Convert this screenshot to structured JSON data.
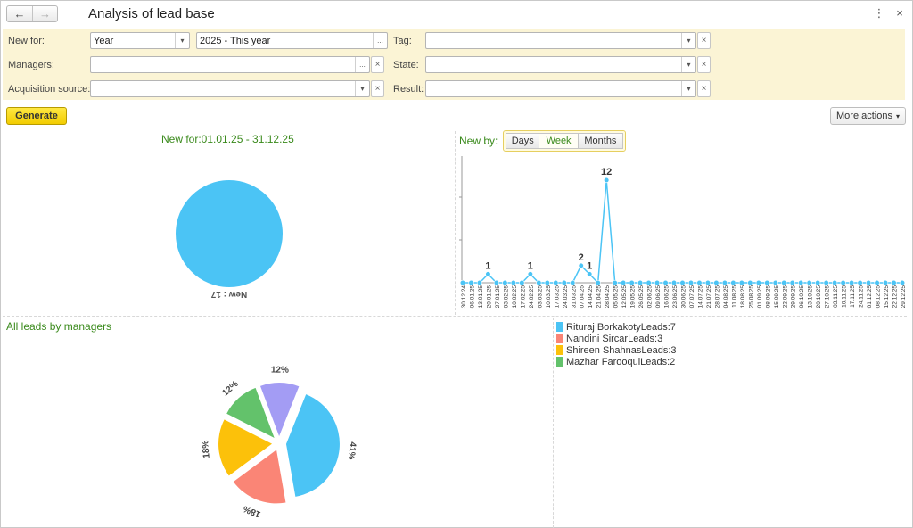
{
  "header": {
    "title": "Analysis of lead base",
    "back_icon": "←",
    "forward_icon": "→",
    "more_icon": "⋮",
    "close_icon": "×"
  },
  "filters": {
    "new_for_label": "New for:",
    "period_type_value": "Year",
    "period_value": "2025 - This year",
    "managers_label": "Managers:",
    "managers_value": "",
    "acquisition_label": "Acquisition source:",
    "acquisition_value": "",
    "tag_label": "Tag:",
    "tag_value": "",
    "state_label": "State:",
    "state_value": "",
    "result_label": "Result:",
    "result_value": "",
    "dropdown_glyph": "▾",
    "choice_glyph": "...",
    "clear_glyph": "×"
  },
  "actions": {
    "generate_label": "Generate",
    "more_actions_label": "More actions",
    "more_actions_arrow": "▾"
  },
  "new_for_chart": {
    "title": "New for:01.01.25 - 31.12.25",
    "slice_label": "New : 17",
    "color": "#4bc4f5"
  },
  "new_by": {
    "label": "New by:",
    "buttons": [
      "Days",
      "Week",
      "Months"
    ],
    "active": "Week"
  },
  "managers_chart": {
    "title": "All leads by managers"
  },
  "chart_data": [
    {
      "type": "pie",
      "title": "New for:01.01.25 - 31.12.25",
      "slices": [
        {
          "label": "New : 17",
          "value": 17,
          "color": "#4bc4f5"
        }
      ]
    },
    {
      "type": "line",
      "title": "New by:",
      "color": "#4bc4f5",
      "x": [
        "30.12.24",
        "06.01.25",
        "13.01.25",
        "20.01.25",
        "27.01.25",
        "03.02.25",
        "10.02.25",
        "17.02.25",
        "24.02.25",
        "03.03.25",
        "10.03.25",
        "17.03.25",
        "24.03.25",
        "31.03.25",
        "07.04.25",
        "14.04.25",
        "21.04.25",
        "28.04.25",
        "05.05.25",
        "12.05.25",
        "19.05.25",
        "26.05.25",
        "02.06.25",
        "09.06.25",
        "16.06.25",
        "23.06.25",
        "30.06.25",
        "07.07.25",
        "14.07.25",
        "21.07.25",
        "28.07.25",
        "04.08.25",
        "11.08.25",
        "18.08.25",
        "25.08.25",
        "01.09.25",
        "08.09.25",
        "15.09.25",
        "22.09.25",
        "29.09.25",
        "06.10.25",
        "13.10.25",
        "20.10.25",
        "27.10.25",
        "03.11.25",
        "10.11.25",
        "17.11.25",
        "24.11.25",
        "01.12.25",
        "08.12.25",
        "15.12.25",
        "22.12.25",
        "29.12.25"
      ],
      "values": [
        0,
        0,
        0,
        1,
        0,
        0,
        0,
        0,
        1,
        0,
        0,
        0,
        0,
        0,
        2,
        1,
        0,
        12,
        0,
        0,
        0,
        0,
        0,
        0,
        0,
        0,
        0,
        0,
        0,
        0,
        0,
        0,
        0,
        0,
        0,
        0,
        0,
        0,
        0,
        0,
        0,
        0,
        0,
        0,
        0,
        0,
        0,
        0,
        0,
        0,
        0,
        0,
        0
      ],
      "ylim": [
        0,
        12
      ]
    },
    {
      "type": "pie",
      "title": "All leads by managers",
      "slices": [
        {
          "label": "Rituraj BorkakotyLeads:7",
          "value": 7,
          "percent": "41%",
          "color": "#4bc4f5"
        },
        {
          "label": "Nandini SircarLeads:3",
          "value": 3,
          "percent": "18%",
          "color": "#fa8576"
        },
        {
          "label": "Shireen ShahnasLeads:3",
          "value": 3,
          "percent": "18%",
          "color": "#fcc10a"
        },
        {
          "label": "Mazhar FarooquiLeads:2",
          "value": 2,
          "percent": "12%",
          "color": "#63c26b"
        },
        {
          "label": "",
          "value": 2,
          "percent": "12%",
          "color": "#a39cf4"
        }
      ],
      "legend_position": "right"
    }
  ]
}
